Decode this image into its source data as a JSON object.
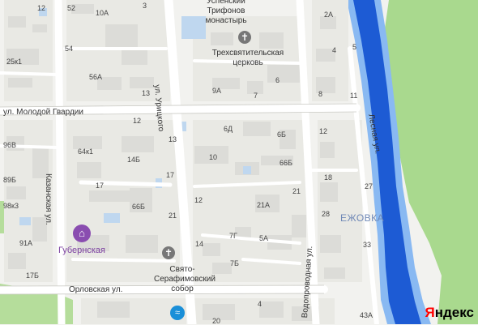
{
  "map": {
    "district": "ЕЖОВКА",
    "brand": {
      "first_letter": "Я",
      "rest": "ндекс",
      "first_color": "#ff0000",
      "rest_color": "#000000"
    },
    "colors": {
      "river": "#1d5bd4",
      "river_bank": "#89b9f2",
      "park": "#a9d98e",
      "road": "#ffffff",
      "building": "#dcdcd8",
      "cyan_building": "#90d5ee"
    },
    "streets": [
      "ул. Молодой Гвардии",
      "ул. Урицкого",
      "Казанская ул.",
      "Орловская ул.",
      "Водопроводная ул.",
      "Лесная ул."
    ],
    "pois": [
      {
        "name": "Успенский Трифонов монастырь",
        "icon": "church-icon"
      },
      {
        "name": "Трехсвятительская церковь",
        "icon": "church-icon"
      },
      {
        "name": "Свято-Серафимовский собор",
        "icon": "church-icon"
      },
      {
        "name": "Губернская",
        "icon": "hotel-icon"
      },
      {
        "name": "",
        "icon": "swimming-icon"
      }
    ],
    "house_numbers": [
      "12",
      "52",
      "10А",
      "3",
      "2А",
      "54",
      "5",
      "4",
      "25к1",
      "56А",
      "6",
      "13",
      "9А",
      "7",
      "8",
      "11",
      "6Д",
      "12",
      "96В",
      "64к1",
      "6Б",
      "13",
      "12",
      "89Б",
      "14Б",
      "10",
      "17",
      "66Б",
      "17",
      "18",
      "21",
      "27",
      "98к3",
      "66Б",
      "12",
      "21А",
      "21",
      "28",
      "91А",
      "7Г",
      "5А",
      "14",
      "33",
      "17Б",
      "7Б",
      "20",
      "4",
      "43А"
    ]
  }
}
